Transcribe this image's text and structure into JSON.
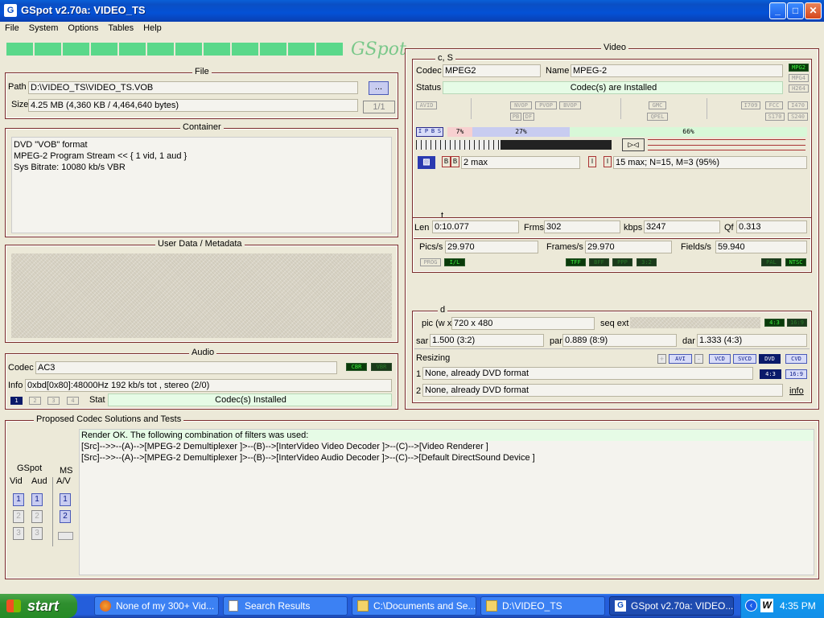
{
  "window": {
    "title": "GSpot v2.70a: VIDEO_TS",
    "app_icon": "gspot-icon"
  },
  "menu": [
    "File",
    "System",
    "Options",
    "Tables",
    "Help"
  ],
  "logo": "GSpot",
  "file": {
    "heading": "File",
    "path_label": "Path",
    "path": "D:\\VIDEO_TS\\VIDEO_TS.VOB",
    "browse": "...",
    "size_label": "Size",
    "size": "4.25 MB (4,360 KB / 4,464,640 bytes)",
    "count": "1/1"
  },
  "container": {
    "heading": "Container",
    "lines": [
      "DVD \"VOB\" format",
      "MPEG-2 Program Stream << { 1 vid, 1 aud }",
      "Sys Bitrate: 10080 kb/s VBR"
    ]
  },
  "userdata": {
    "heading": "User Data / Metadata"
  },
  "audio": {
    "heading": "Audio",
    "codec_label": "Codec",
    "codec": "AC3",
    "cbr": "CBR",
    "vbr": "VBR",
    "info_label": "Info",
    "info": "0xbd[0x80]:48000Hz  192 kb/s tot , stereo (2/0)",
    "streams": [
      "1",
      "2",
      "3",
      "4"
    ],
    "stat_label": "Stat",
    "stat": "Codec(s) Installed"
  },
  "video": {
    "heading": "Video",
    "cs_heading": "c, S",
    "codec_label": "Codec",
    "codec": "MPEG2",
    "name_label": "Name",
    "name": "MPEG-2",
    "status_label": "Status",
    "status": "Codec(s) are Installed",
    "std_leds": [
      "MPG2",
      "MPG4",
      "H264"
    ],
    "flag_leds": [
      "AVID",
      "NVOP",
      "PVOP",
      "BVOP",
      "PB",
      "DF",
      "GMC",
      "QPEL",
      "I709",
      "FCC",
      "I470",
      "S170",
      "S240"
    ],
    "frame_types": [
      "I",
      "P",
      "B",
      "S"
    ],
    "frame_dist": {
      "i_pct": "7%",
      "p_pct": "27%",
      "b_pct": "66%",
      "i": 0.07,
      "p": 0.27,
      "b": 0.66
    },
    "b_frames": "2 max",
    "gop": "15 max; N=15, M=3 (95%)",
    "t_heading": "t",
    "len_label": "Len",
    "len": "0:10.077",
    "frms_label": "Frms",
    "frms": "302",
    "kbps_label": "kbps",
    "kbps": "3247",
    "qf_label": "Qf",
    "qf": "0.313",
    "pics_label": "Pics/s",
    "pics": "29.970",
    "frames_label": "Frames/s",
    "frames": "29.970",
    "fields_label": "Fields/s",
    "fields": "59.940",
    "t_leds": [
      "PROG",
      "I/L",
      "TFF",
      "BFF",
      "PPP",
      "3:2",
      "PAL",
      "NTSC"
    ],
    "d_heading": "d",
    "pic_label": "pic (w x",
    "pic": "720 x 480",
    "seqext_label": "seq ext",
    "ar_leds": [
      "4:3",
      "16:9"
    ],
    "sar_label": "sar",
    "sar": "1.500 (3:2)",
    "par_label": "par",
    "par": "0.889 (8:9)",
    "dar_label": "dar",
    "dar": "1.333 (4:3)",
    "resizing_label": "Resizing",
    "resize_plus": "+",
    "resize_avi": "AVI",
    "resize_minus": "-",
    "resize_fmts": [
      "VCD",
      "SVCD",
      "DVD",
      "CVD"
    ],
    "resize_ar": [
      "4:3",
      "16:9"
    ],
    "resize1_label": "1",
    "resize1": "None, already DVD format",
    "resize2_label": "2",
    "resize2": "None, already DVD format",
    "info_link": "info"
  },
  "proposed": {
    "heading": "Proposed Codec Solutions and Tests",
    "gspot_label": "GSpot",
    "ms_label": "MS",
    "vid_label": "Vid",
    "aud_label": "Aud",
    "av_label": "A/V",
    "btns": [
      "1",
      "2",
      "3"
    ],
    "lines": [
      "Render OK.  The following combination of filters was used:",
      "[Src]-->>--(A)-->[MPEG-2 Demultiplexer ]>--(B)-->[InterVideo Video Decoder ]>--(C)-->[Video Renderer ]",
      "[Src]-->>--(A)-->[MPEG-2 Demultiplexer ]>--(B)-->[InterVideo Audio Decoder ]>--(C)-->[Default DirectSound Device ]"
    ]
  },
  "taskbar": {
    "start": "start",
    "items": [
      "None of my 300+ Vid...",
      "Search Results",
      "C:\\Documents and Se...",
      "D:\\VIDEO_TS",
      "GSpot v2.70a: VIDEO..."
    ],
    "clock": "4:35 PM"
  }
}
